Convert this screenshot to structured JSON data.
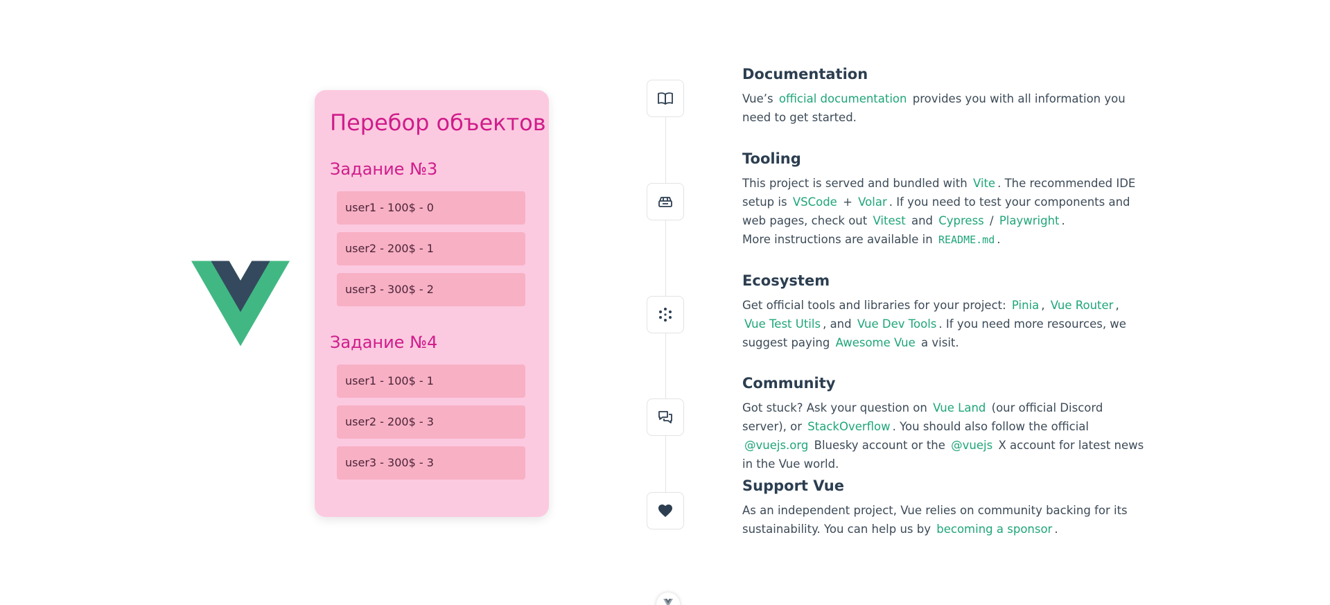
{
  "logo": {
    "name": "vue-logo",
    "colors": {
      "outer": "#41b883",
      "inner": "#34495e"
    }
  },
  "card": {
    "title": "Перебор объектов",
    "tasks": [
      {
        "title": "Задание №3",
        "items": [
          "user1 - 100$ - 0",
          "user2 - 200$ - 1",
          "user3 - 300$ - 2"
        ]
      },
      {
        "title": "Задание №4",
        "items": [
          "user1 - 100$ - 1",
          "user2 - 200$ - 3",
          "user3 - 300$ - 3"
        ]
      }
    ],
    "colors": {
      "background": "#fccae0",
      "heading": "#d01c8b",
      "item": "#f8b0c5"
    }
  },
  "timeline": {
    "icons": [
      "book-icon",
      "tooling-icon",
      "ecosystem-icon",
      "community-icon",
      "heart-icon"
    ]
  },
  "sections": {
    "documentation": {
      "title": "Documentation",
      "t1": "Vue’s",
      "link_docs": "official documentation",
      "t2": "provides you with all information you need to get started."
    },
    "tooling": {
      "title": "Tooling",
      "t1": "This project is served and bundled with",
      "link_vite": "Vite",
      "t2": ". The recommended IDE setup is",
      "link_vscode": "VSCode",
      "t3": "+",
      "link_volar": "Volar",
      "t4": ". If you need to test your components and web pages, check out",
      "link_vitest": "Vitest",
      "t5": "and",
      "link_cypress": "Cypress",
      "t6": "/",
      "link_playwright": "Playwright",
      "t7": ".",
      "t8": "More instructions are available in",
      "code_readme": "README.md",
      "t9": "."
    },
    "ecosystem": {
      "title": "Ecosystem",
      "t1": "Get official tools and libraries for your project:",
      "link_pinia": "Pinia",
      "t2": ",",
      "link_router": "Vue Router",
      "t3": ",",
      "link_testutils": "Vue Test Utils",
      "t4": ", and",
      "link_devtools": "Vue Dev Tools",
      "t5": ". If you need more resources, we suggest paying",
      "link_awesome": "Awesome Vue",
      "t6": "a visit."
    },
    "community": {
      "title": "Community",
      "t1": "Got stuck? Ask your question on",
      "link_vueland": "Vue Land",
      "t2": "(our official Discord server), or",
      "link_stackoverflow": "StackOverflow",
      "t3": ". You should also follow the official",
      "link_bluesky": "@vuejs.org",
      "t4": "Bluesky account or the",
      "link_x": "@vuejs",
      "t5": "X account for latest news in the Vue world."
    },
    "support": {
      "title": "Support Vue",
      "t1": "As an independent project, Vue relies on community backing for its sustainability. You can help us by",
      "link_sponsor": "becoming a sponsor",
      "t2": "."
    }
  },
  "colors": {
    "link": "#1fa57a",
    "text": "#3c4a57",
    "heading": "#2c3e50"
  }
}
